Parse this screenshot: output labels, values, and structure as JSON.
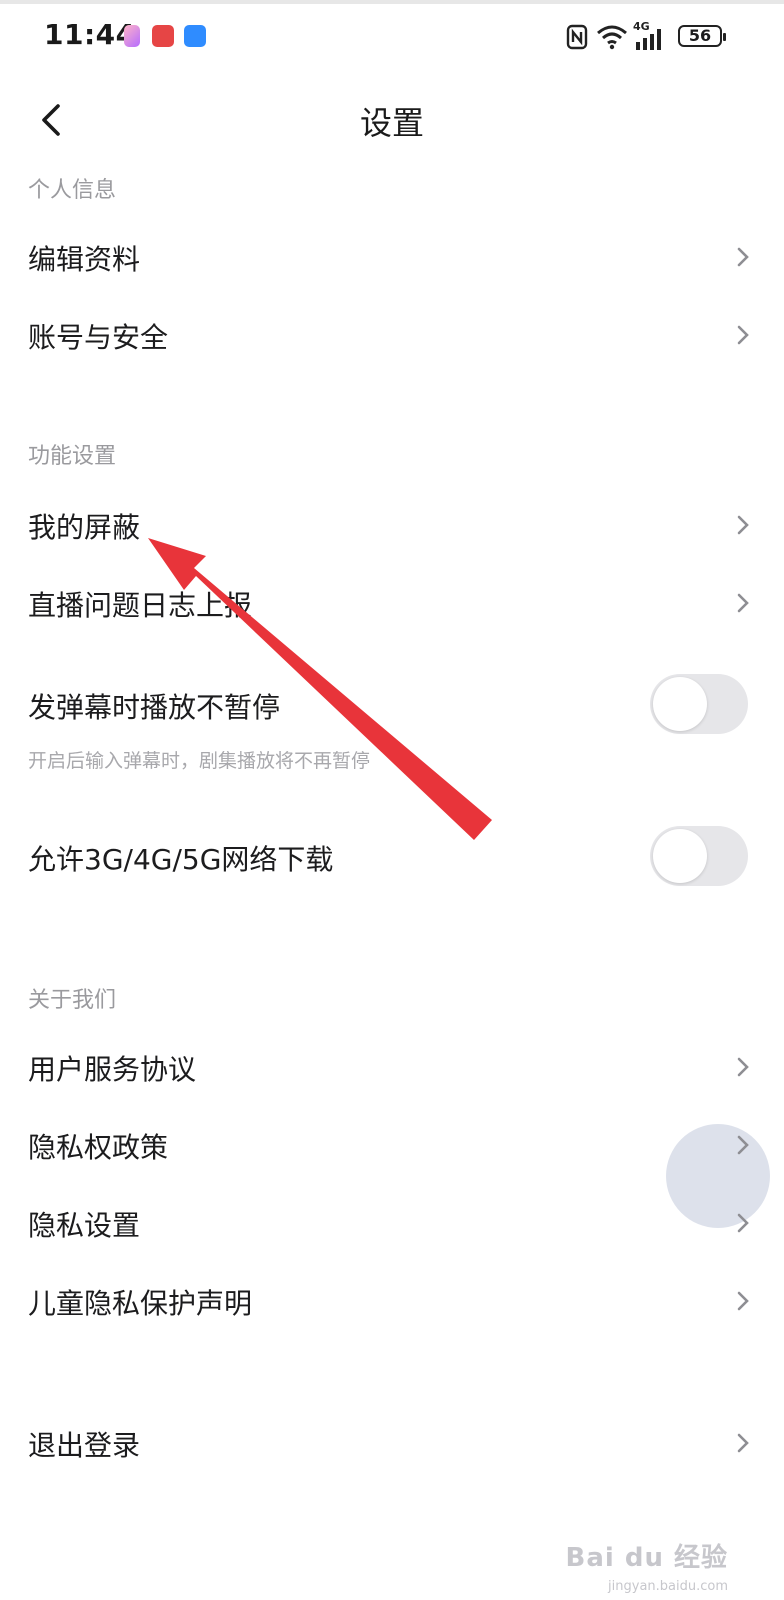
{
  "status_bar": {
    "time": "11:44",
    "battery": "56",
    "network_label": "4G",
    "icons": [
      "nfc-icon",
      "wifi-icon",
      "signal-icon",
      "battery-icon"
    ]
  },
  "header": {
    "title": "设置"
  },
  "sections": {
    "personal": {
      "title": "个人信息",
      "items": [
        "编辑资料",
        "账号与安全"
      ]
    },
    "features": {
      "title": "功能设置",
      "items": [
        "我的屏蔽",
        "直播问题日志上报"
      ],
      "toggle_danmaku": {
        "label": "发弹幕时播放不暂停",
        "hint": "开启后输入弹幕时，剧集播放将不再暂停",
        "on": false
      },
      "toggle_network": {
        "label": "允许3G/4G/5G网络下载",
        "on": false
      }
    },
    "about": {
      "title": "关于我们",
      "items": [
        "用户服务协议",
        "隐私权政策",
        "隐私设置",
        "儿童隐私保护声明"
      ]
    },
    "logout": {
      "label": "退出登录"
    }
  },
  "watermark": {
    "brand": "Bai du 经验",
    "url": "jingyan.baidu.com"
  },
  "colors": {
    "annotation_arrow": "#e8343a",
    "toggle_off": "#e6e6e9",
    "section_title": "#9a9a9e"
  }
}
